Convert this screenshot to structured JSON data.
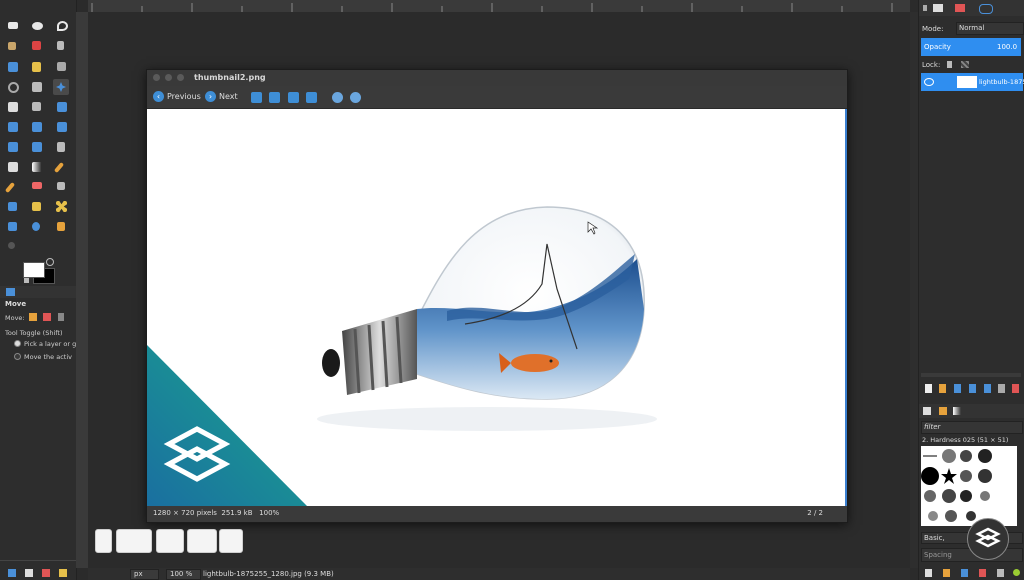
{
  "viewer": {
    "title": "thumbnail2.png",
    "prev_label": "Previous",
    "next_label": "Next",
    "status_left": "1280 × 720 pixels  251.9 kB   100%",
    "status_right": "2 / 2"
  },
  "tool_options": {
    "title": "Move",
    "move_label": "Move:",
    "toggle_label": "Tool Toggle  (Shift)",
    "option1": "Pick a layer or g",
    "option2": "Move the activ"
  },
  "layers": {
    "mode_label": "Mode:",
    "mode_value": "Normal",
    "opacity_label": "Opacity",
    "opacity_value": "100.0",
    "lock_label": "Lock:",
    "layer_name": "lightbulb-1875"
  },
  "brushes": {
    "filter_placeholder": "filter",
    "brush_name": "2. Hardness 025 (51 × 51)",
    "preset": "Basic,",
    "spacing_label": "Spacing"
  },
  "statusbar": {
    "unit": "px",
    "zoom": "100 %",
    "file_info": "lightbulb-1875255_1280.jpg (9.3 MB)"
  },
  "colors": {
    "accent": "#2f8ef0",
    "teal": "#1a8a8a",
    "water": "#2b6cb0",
    "fish": "#e0702a"
  }
}
